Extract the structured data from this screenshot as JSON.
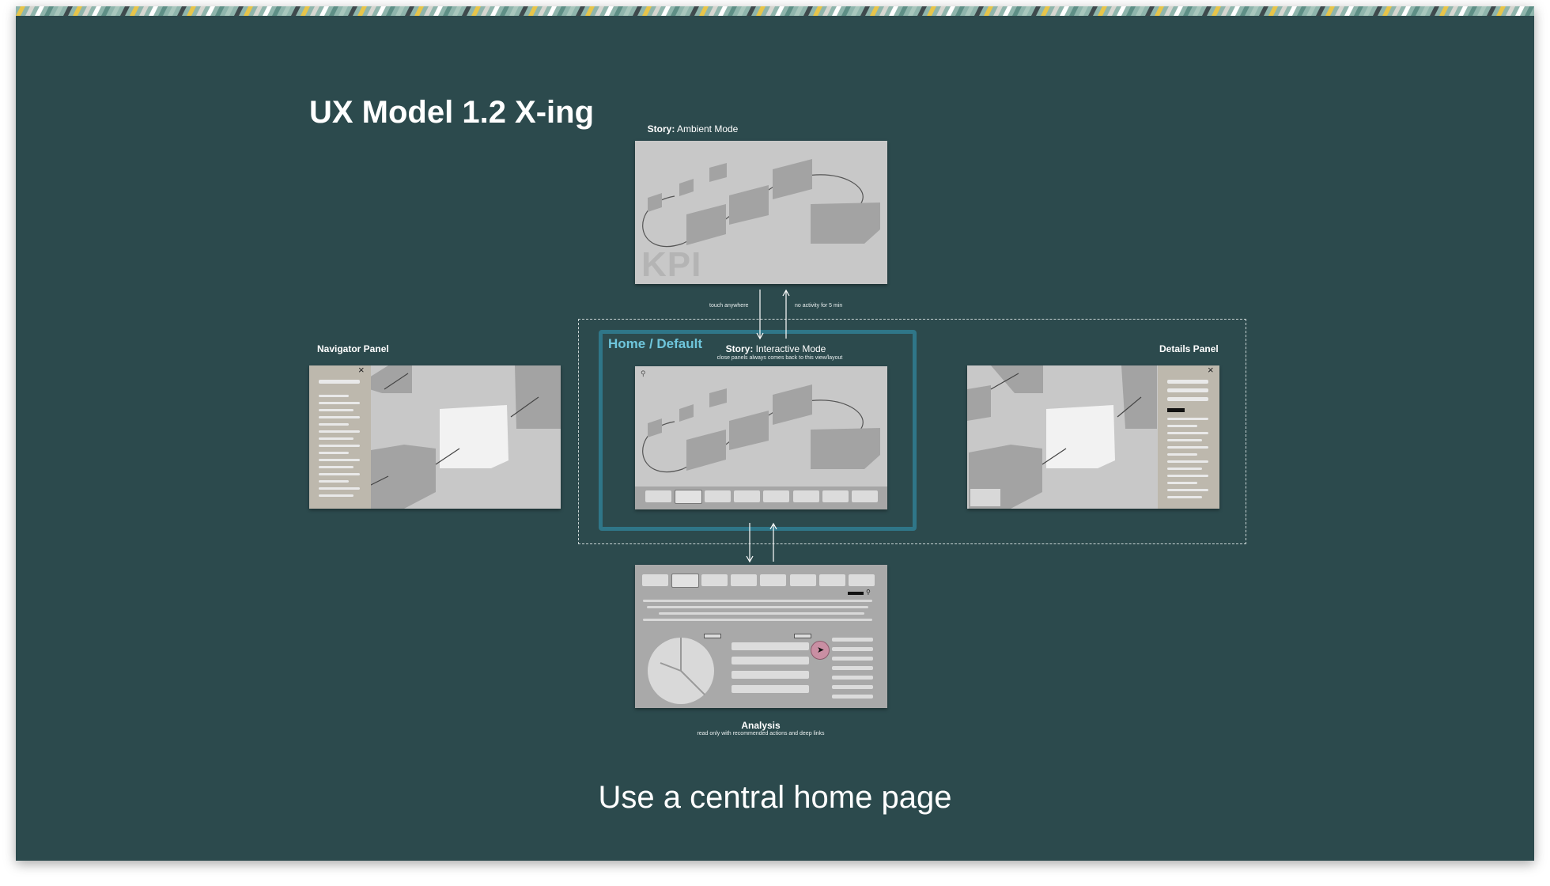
{
  "slide": {
    "title": "UX Model 1.2 X-ing",
    "subtitle": "Use a central home page"
  },
  "ambient": {
    "label_bold": "Story:",
    "label_rest": " Ambient Mode",
    "watermark": "KPI"
  },
  "arrows": {
    "down_label": "touch anywhere",
    "up_label": "no activity for 5 min"
  },
  "home": {
    "frame_label": "Home / Default",
    "label_bold": "Story:",
    "label_rest": " Interactive Mode",
    "sub_label": "close panels always comes back to this view/layout"
  },
  "navigator": {
    "label": "Navigator Panel",
    "close_glyph": "×"
  },
  "details": {
    "label": "Details Panel",
    "close_glyph": "×"
  },
  "analysis": {
    "label": "Analysis",
    "sub_label": "read only with recommended actions and deep links"
  },
  "colors": {
    "background": "#2c4a4d",
    "highlight_frame": "#2f7688",
    "highlight_label": "#6fc6dc",
    "thumbnail": "#c8c8c8",
    "cube": "#9e9e9e",
    "cursor_ring": "#c98fa3"
  },
  "icons": [
    "search-icon",
    "close-icon",
    "cursor-icon",
    "search-icon-small"
  ]
}
